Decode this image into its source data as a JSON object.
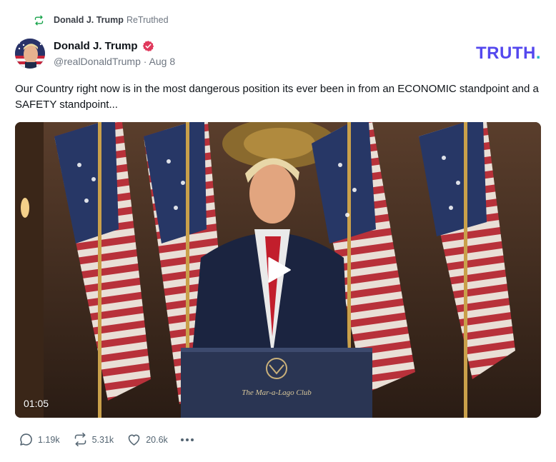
{
  "retruth": {
    "icon": "retruth-icon",
    "user": "Donald J. Trump",
    "action": "ReTruthed"
  },
  "post": {
    "author_name": "Donald J. Trump",
    "verified_icon": "verified-badge-icon",
    "handle": "@realDonaldTrump",
    "separator": "·",
    "date": "Aug 8",
    "text": "Our Country right now is in the most dangerous position its ever been in from an ECONOMIC standpoint and a SAFETY standpoint...",
    "video": {
      "duration": "01:05",
      "play_icon": "play-icon",
      "podium_caption": "The Mar-a-Lago Club"
    }
  },
  "brand": {
    "logo_text": "TRUTH",
    "logo_dot": ".",
    "color": "#5448ee",
    "dot_color": "#26b8c8"
  },
  "actions": {
    "replies": "1.19k",
    "retruths": "5.31k",
    "likes": "20.6k"
  },
  "colors": {
    "verified": "#e0395c",
    "retruth_icon": "#17a34a",
    "text_muted": "#6e7681"
  }
}
